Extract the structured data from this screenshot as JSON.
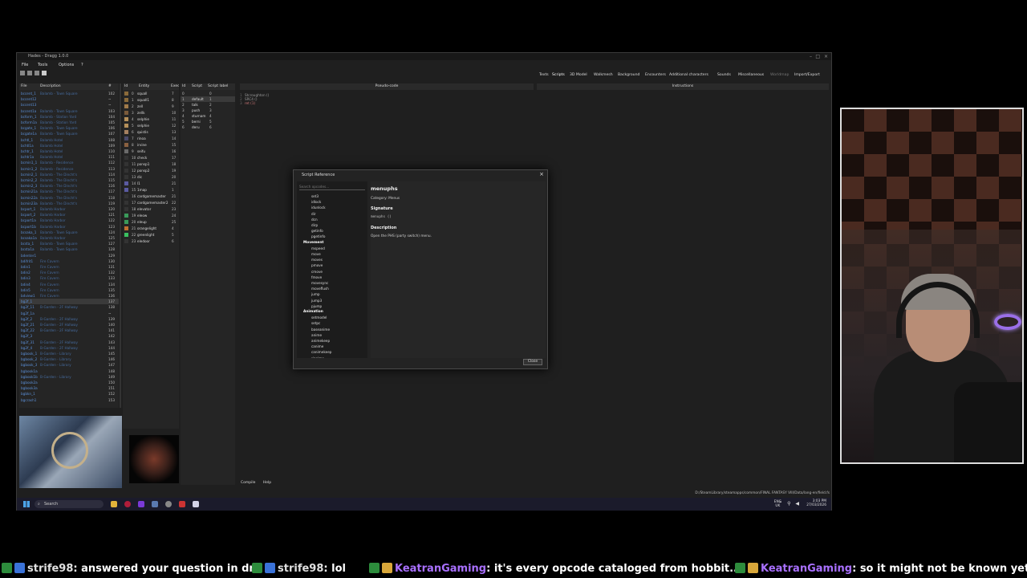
{
  "window": {
    "title": "Hades - Dragg 1.0.0",
    "menu": [
      "File",
      "Tools",
      "Options",
      "?"
    ],
    "tabs": [
      "Texts",
      "Scripts",
      "3D Model",
      "Walkmesh",
      "Background",
      "Encounters",
      "Additional characters",
      "Sounds",
      "Miscellaneous",
      "Worldmap",
      "Import/Export"
    ],
    "active_tab": "Scripts"
  },
  "files": {
    "headers": [
      "File",
      "Description",
      "#"
    ],
    "rows": [
      [
        "bccent_1",
        "Balamb - Town Square",
        "102"
      ],
      [
        "bccent12",
        "",
        "~"
      ],
      [
        "bccent13",
        "",
        "~"
      ],
      [
        "bccent1a",
        "Balamb - Town Square",
        "103"
      ],
      [
        "bcform_1",
        "Balamb - Station Yard",
        "104"
      ],
      [
        "bcform1a",
        "Balamb - Station Yard",
        "105"
      ],
      [
        "bcgate_1",
        "Balamb - Town Square",
        "106"
      ],
      [
        "bcgate1a",
        "Balamb - Town Square",
        "107"
      ],
      [
        "bchtl_1",
        "Balamb Hotel",
        "108"
      ],
      [
        "bchtl1a",
        "Balamb Hotel",
        "109"
      ],
      [
        "bchtr_1",
        "Balamb Hotel",
        "110"
      ],
      [
        "bchtr1a",
        "Balamb Hotel",
        "111"
      ],
      [
        "bcmin1_1",
        "Balamb - Residence",
        "112"
      ],
      [
        "bcmin1_2",
        "Balamb - Residence",
        "113"
      ],
      [
        "bcmin2_1",
        "Balamb - The Dincht's",
        "114"
      ],
      [
        "bcmin2_2",
        "Balamb - The Dincht's",
        "115"
      ],
      [
        "bcmin2_3",
        "Balamb - The Dincht's",
        "116"
      ],
      [
        "bcmin21a",
        "Balamb - The Dincht's",
        "117"
      ],
      [
        "bcmin22a",
        "Balamb - The Dincht's",
        "118"
      ],
      [
        "bcmin23a",
        "Balamb - The Dincht's",
        "119"
      ],
      [
        "bcport_1",
        "Balamb Harbor",
        "120"
      ],
      [
        "bcport_2",
        "Balamb Harbor",
        "121"
      ],
      [
        "bcport1a",
        "Balamb Harbor",
        "122"
      ],
      [
        "bcport1b",
        "Balamb Harbor",
        "123"
      ],
      [
        "bcsaka_1",
        "Balamb - Town Square",
        "124"
      ],
      [
        "bcsaka1a",
        "Balamb Harbor",
        "125"
      ],
      [
        "bcsta_1",
        "Balamb - Town Square",
        "127"
      ],
      [
        "bcsta1a",
        "Balamb - Town Square",
        "128"
      ],
      [
        "bdenter1",
        "",
        "129"
      ],
      [
        "bdifrit1",
        "Fire Cavern",
        "130"
      ],
      [
        "bdin1",
        "Fire Cavern",
        "131"
      ],
      [
        "bdin2",
        "Fire Cavern",
        "132"
      ],
      [
        "bdin3",
        "Fire Cavern",
        "133"
      ],
      [
        "bdin4",
        "Fire Cavern",
        "134"
      ],
      [
        "bdin5",
        "Fire Cavern",
        "135"
      ],
      [
        "bdview1",
        "Fire Cavern",
        "136"
      ],
      [
        "bg2f_1",
        "",
        "137"
      ],
      [
        "bg2f_11",
        "B-Garden - 2F Hallway",
        "138"
      ],
      [
        "bg2f_1a",
        "",
        "~"
      ],
      [
        "bg2f_2",
        "B-Garden - 2F Hallway",
        "139"
      ],
      [
        "bg2f_21",
        "B-Garden - 2F Hallway",
        "140"
      ],
      [
        "bg2f_22",
        "B-Garden - 2F Hallway",
        "141"
      ],
      [
        "bg2f_3",
        "",
        "142"
      ],
      [
        "bg2f_31",
        "B-Garden - 2F Hallway",
        "143"
      ],
      [
        "bg2f_4",
        "B-Garden - 2F Hallway",
        "144"
      ],
      [
        "bgbook_1",
        "B-Garden - Library",
        "145"
      ],
      [
        "bgbook_2",
        "B-Garden - Library",
        "146"
      ],
      [
        "bgbook_3",
        "B-Garden - Library",
        "147"
      ],
      [
        "bgbook1a",
        "",
        "148"
      ],
      [
        "bgbook1b",
        "B-Garden - Library",
        "149"
      ],
      [
        "bgbook2a",
        "",
        "150"
      ],
      [
        "bgbook3a",
        "",
        "151"
      ],
      [
        "bgbkn_1",
        "",
        "152"
      ],
      [
        "bgcrash1",
        "",
        "153"
      ]
    ]
  },
  "entities": {
    "headers": [
      "Id",
      "Entity",
      "Exec"
    ],
    "rows": [
      [
        "0",
        "squall",
        "7"
      ],
      [
        "1",
        "squall1",
        "8"
      ],
      [
        "2",
        "zell",
        "9"
      ],
      [
        "3",
        "zellk",
        "10"
      ],
      [
        "4",
        "selphie",
        "11"
      ],
      [
        "5",
        "selphie",
        "12"
      ],
      [
        "6",
        "quistis",
        "13"
      ],
      [
        "7",
        "rinoa",
        "14"
      ],
      [
        "8",
        "irvine",
        "15"
      ],
      [
        "9",
        "seifu",
        "16"
      ],
      [
        "10",
        "check",
        "17"
      ],
      [
        "11",
        "ponsp1",
        "18"
      ],
      [
        "12",
        "ponsp2",
        "19"
      ],
      [
        "13",
        "dic",
        "20"
      ],
      [
        "14",
        "l1",
        "21"
      ],
      [
        "15",
        "1map",
        "1"
      ],
      [
        "16",
        "cardgamemaster",
        "21"
      ],
      [
        "17",
        "cardgamemaster2",
        "22"
      ],
      [
        "18",
        "elevator",
        "23"
      ],
      [
        "19",
        "eleow",
        "24"
      ],
      [
        "20",
        "eleup",
        "25"
      ],
      [
        "21",
        "orangelight",
        "4"
      ],
      [
        "22",
        "greenlight",
        "5"
      ],
      [
        "23",
        "eledoor",
        "6"
      ]
    ]
  },
  "scripts": {
    "headers": [
      "Id",
      "Script",
      "Script label"
    ],
    "rows": [
      [
        "0",
        "",
        "0"
      ],
      [
        "1",
        "default",
        "1"
      ],
      [
        "2",
        "talk",
        "2"
      ],
      [
        "3",
        "push",
        "3"
      ],
      [
        "4",
        "sturnam",
        "4"
      ],
      [
        "5",
        "berni",
        "5"
      ],
      [
        "6",
        "deru",
        "6"
      ]
    ]
  },
  "editor": {
    "pseudo_header": "Pseudo-code",
    "instructions_header": "Instructions",
    "code_lines": [
      "Stcroughton ()",
      "SRC4 ()",
      "ret (1)"
    ],
    "compile_label": "Compile",
    "help_label": "Help",
    "path": "D:/SteamLibrary/steamapps/common/FINAL FANTASY VIII/Data/lang-en/field.fs"
  },
  "dialog": {
    "title": "Script Reference",
    "search_placeholder": "Search opcodes...",
    "ops_top": [
      "set3",
      "idlock",
      "idunlock",
      "dir",
      "dcn",
      "dirp",
      "getinfo",
      "pgetinfo"
    ],
    "group_movement": "Movement",
    "ops_movement": [
      "mspeed",
      "move",
      "moves",
      "pmove",
      "cmove",
      "fmove",
      "movesync",
      "moveflush",
      "jump",
      "jump3",
      "pjump"
    ],
    "group_animation": "Animation",
    "ops_animation": [
      "setmodel",
      "setpc",
      "baseanime",
      "anime",
      "animekeep",
      "canime",
      "canimekeep",
      "rjanime"
    ],
    "selected_name": "menuphs",
    "category": "Category: Menus",
    "signature_heading": "Signature",
    "signature": "menuphs ()",
    "description_heading": "Description",
    "description": "Open the PHS (party switch) menu.",
    "close_label": "Close"
  },
  "taskbar": {
    "search_label": "Search",
    "lang1": "ENG",
    "lang2": "UK",
    "time": "3:03 PM",
    "date": "27/03/2026"
  },
  "chat": {
    "messages": [
      {
        "user": "strife98",
        "text": ": answered your question in dm"
      },
      {
        "user": "strife98",
        "text": ": lol"
      },
      {
        "user": "KeatranGaming",
        "text": ": it's every opcode cataloged from hobbit..."
      },
      {
        "user": "KeatranGaming",
        "text": ": so it might not be known yet"
      }
    ]
  }
}
